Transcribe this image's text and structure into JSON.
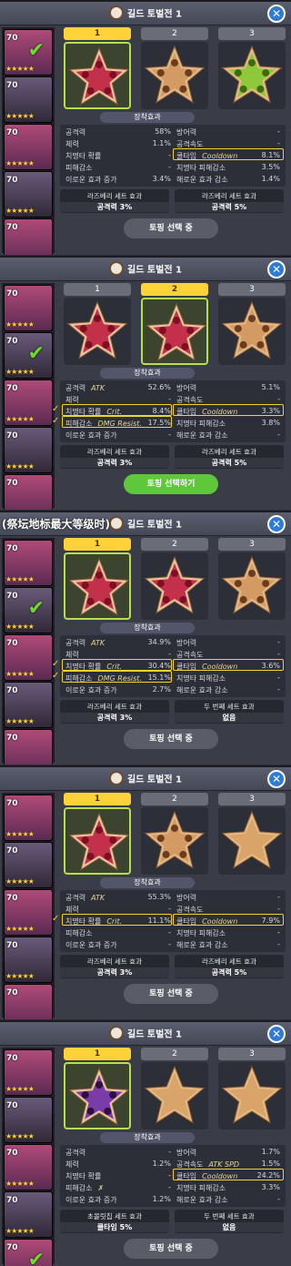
{
  "panels": [
    {
      "overlay_label": "",
      "title": "길드 토벌전 1",
      "close_label": "✕",
      "roster": [
        {
          "level": "70",
          "stars": "★★★★★",
          "checked": true
        },
        {
          "level": "70",
          "stars": "★★★★★",
          "checked": false
        },
        {
          "level": "70",
          "stars": "★★★★★",
          "checked": false
        },
        {
          "level": "70",
          "stars": "★★★★★",
          "checked": false
        },
        {
          "level": "70",
          "stars": "★★★★★",
          "checked": false
        }
      ],
      "tabs": [
        "1",
        "2",
        "3"
      ],
      "active_tab": 0,
      "toppings": [
        "raspberry",
        "almond",
        "apple-jelly"
      ],
      "effects_label": "장착효과",
      "stats": [
        {
          "l1": "공격력",
          "n1": "",
          "v1": "58%",
          "l2": "방어력",
          "n2": "",
          "v2": "-"
        },
        {
          "l1": "체력",
          "n1": "",
          "v1": "1.1%",
          "l2": "공격속도",
          "n2": "",
          "v2": "-"
        },
        {
          "l1": "치명타 확률",
          "n1": "",
          "v1": "-",
          "l2": "쿨타임",
          "n2": "Cooldown",
          "v2": "8.1%"
        },
        {
          "l1": "피해감소",
          "n1": "",
          "v1": "-",
          "l2": "치명타 피해감소",
          "n2": "",
          "v2": "3.5%"
        },
        {
          "l1": "이로운 효과 증가",
          "n1": "",
          "v1": "3.4%",
          "l2": "해로운 효과 감소",
          "n2": "",
          "v2": "1.4%"
        }
      ],
      "highlights": [
        "r2"
      ],
      "set_left": {
        "name": "라즈베리 세트 효과",
        "value": "공격력 3%"
      },
      "set_right": {
        "name": "라즈베리 세트 효과",
        "value": "공격력 5%"
      },
      "action": "토핑 선택 중",
      "action_green": false
    },
    {
      "overlay_label": "",
      "title": "길드 토벌전 1",
      "close_label": "✕",
      "roster": [
        {
          "level": "70",
          "stars": "★★★★★",
          "checked": false
        },
        {
          "level": "70",
          "stars": "★★★★★",
          "checked": true
        },
        {
          "level": "70",
          "stars": "★★★★★",
          "checked": false
        },
        {
          "level": "70",
          "stars": "★★★★★",
          "checked": false
        },
        {
          "level": "70",
          "stars": "★★★★★",
          "checked": false
        }
      ],
      "tabs": [
        "1",
        "2",
        "3"
      ],
      "active_tab": 1,
      "toppings": [
        "raspberry",
        "raspberry",
        "almond"
      ],
      "effects_label": "장착효과",
      "stats": [
        {
          "l1": "공격력",
          "n1": "ATK",
          "v1": "52.6%",
          "l2": "방어력",
          "n2": "",
          "v2": "5.1%"
        },
        {
          "l1": "체력",
          "n1": "",
          "v1": "-",
          "l2": "공격속도",
          "n2": "",
          "v2": "-"
        },
        {
          "l1": "치명타 확률",
          "n1": "Crit.",
          "v1": "8.4%",
          "l2": "쿨타임",
          "n2": "Cooldown",
          "v2": "3.3%"
        },
        {
          "l1": "피해감소",
          "n1": "DMG Resist.",
          "v1": "17.5%",
          "l2": "치명타 피해감소",
          "n2": "",
          "v2": "3.8%"
        },
        {
          "l1": "이로운 효과 증가",
          "n1": "",
          "v1": "-",
          "l2": "해로운 효과 감소",
          "n2": "",
          "v2": "-"
        }
      ],
      "highlights": [
        "l2",
        "l3",
        "r2"
      ],
      "set_left": {
        "name": "라즈베리 세트 효과",
        "value": "공격력 3%"
      },
      "set_right": {
        "name": "라즈베리 세트 효과",
        "value": "공격력 5%"
      },
      "action": "토핑 선택하기",
      "action_green": true
    },
    {
      "overlay_label": "(祭坛地标最大等级时)",
      "title": "길드 토벌전 1",
      "close_label": "✕",
      "roster": [
        {
          "level": "70",
          "stars": "★★★★★",
          "checked": false
        },
        {
          "level": "70",
          "stars": "★★★★★",
          "checked": true
        },
        {
          "level": "70",
          "stars": "★★★★★",
          "checked": false
        },
        {
          "level": "70",
          "stars": "★★★★★",
          "checked": false
        },
        {
          "level": "70",
          "stars": "★★★★★",
          "checked": false
        }
      ],
      "tabs": [
        "1",
        "2",
        "3"
      ],
      "active_tab": 0,
      "toppings": [
        "raspberry",
        "raspberry",
        "almond"
      ],
      "effects_label": "장착효과",
      "stats": [
        {
          "l1": "공격력",
          "n1": "ATK",
          "v1": "34.9%",
          "l2": "방어력",
          "n2": "",
          "v2": "-"
        },
        {
          "l1": "체력",
          "n1": "",
          "v1": "-",
          "l2": "공격속도",
          "n2": "",
          "v2": "-"
        },
        {
          "l1": "치명타 확률",
          "n1": "Crit.",
          "v1": "30.4%",
          "l2": "쿨타임",
          "n2": "Cooldown",
          "v2": "3.6%"
        },
        {
          "l1": "피해감소",
          "n1": "DMG Resist.",
          "v1": "15.1%",
          "l2": "치명타 피해감소",
          "n2": "",
          "v2": "-"
        },
        {
          "l1": "이로운 효과 증가",
          "n1": "",
          "v1": "2.7%",
          "l2": "해로운 효과 감소",
          "n2": "",
          "v2": "-"
        }
      ],
      "highlights": [
        "l2",
        "l3",
        "r2"
      ],
      "set_left": {
        "name": "라즈베리 세트 효과",
        "value": "공격력 3%"
      },
      "set_right": {
        "name": "두 번째 세트 효과",
        "value": "없음"
      },
      "action": "토핑 선택 중",
      "action_green": false
    },
    {
      "overlay_label": "",
      "title": "길드 토벌전 1",
      "close_label": "✕",
      "roster": [
        {
          "level": "70",
          "stars": "★★★★★",
          "checked": false
        },
        {
          "level": "70",
          "stars": "★★★★★",
          "checked": false
        },
        {
          "level": "70",
          "stars": "★★★★★",
          "checked": false
        },
        {
          "level": "70",
          "stars": "★★★★★",
          "checked": false
        },
        {
          "level": "70",
          "stars": "★★★★★",
          "checked": false
        }
      ],
      "tabs": [
        "1",
        "2",
        "3"
      ],
      "active_tab": 0,
      "toppings": [
        "raspberry",
        "almond",
        "empty"
      ],
      "effects_label": "장착효과",
      "stats": [
        {
          "l1": "공격력",
          "n1": "ATK",
          "v1": "55.3%",
          "l2": "방어력",
          "n2": "",
          "v2": "-"
        },
        {
          "l1": "체력",
          "n1": "",
          "v1": "-",
          "l2": "공격속도",
          "n2": "",
          "v2": "-"
        },
        {
          "l1": "치명타 확률",
          "n1": "Crit.",
          "v1": "11.1%",
          "l2": "쿨타임",
          "n2": "Cooldown",
          "v2": "7.9%"
        },
        {
          "l1": "피해감소",
          "n1": "",
          "v1": "-",
          "l2": "치명타 피해감소",
          "n2": "",
          "v2": "-"
        },
        {
          "l1": "이로운 효과 증가",
          "n1": "",
          "v1": "-",
          "l2": "해로운 효과 감소",
          "n2": "",
          "v2": "-"
        }
      ],
      "highlights": [
        "l2",
        "r2"
      ],
      "set_left": {
        "name": "라즈베리 세트 효과",
        "value": "공격력 3%"
      },
      "set_right": {
        "name": "라즈베리 세트 효과",
        "value": "공격력 5%"
      },
      "action": "토핑 선택 중",
      "action_green": false
    },
    {
      "overlay_label": "",
      "title": "길드 토벌전 1",
      "close_label": "✕",
      "roster": [
        {
          "level": "70",
          "stars": "★★★★★",
          "checked": false
        },
        {
          "level": "70",
          "stars": "★★★★★",
          "checked": false
        },
        {
          "level": "70",
          "stars": "★★★★★",
          "checked": false
        },
        {
          "level": "70",
          "stars": "★★★★★",
          "checked": false
        },
        {
          "level": "70",
          "stars": "★★★★★",
          "checked": true
        }
      ],
      "tabs": [
        "1",
        "2",
        "3"
      ],
      "active_tab": 0,
      "toppings": [
        "choco",
        "empty",
        "empty"
      ],
      "effects_label": "장착효과",
      "stats": [
        {
          "l1": "공격력",
          "n1": "",
          "v1": "-",
          "l2": "방어력",
          "n2": "",
          "v2": "1.7%"
        },
        {
          "l1": "체력",
          "n1": "",
          "v1": "1.2%",
          "l2": "공격속도",
          "n2": "ATK SPD",
          "v2": "1.5%"
        },
        {
          "l1": "치명타 확률",
          "n1": "",
          "v1": "-",
          "l2": "쿨타임",
          "n2": "Cooldown",
          "v2": "24.2%"
        },
        {
          "l1": "피해감소",
          "n1": "✗",
          "v1": "-",
          "l2": "치명타 피해감소",
          "n2": "",
          "v2": "3.3%"
        },
        {
          "l1": "이로운 효과 증가",
          "n1": "",
          "v1": "1.2%",
          "l2": "해로운 효과 감소",
          "n2": "",
          "v2": "-"
        }
      ],
      "highlights": [
        "r2"
      ],
      "set_left": {
        "name": "초콜릿칩 세트 효과",
        "value": "쿨타임 5%"
      },
      "set_right": {
        "name": "두 번째 세트 효과",
        "value": "없음"
      },
      "action": "토핑 선택 중",
      "action_green": false
    }
  ]
}
